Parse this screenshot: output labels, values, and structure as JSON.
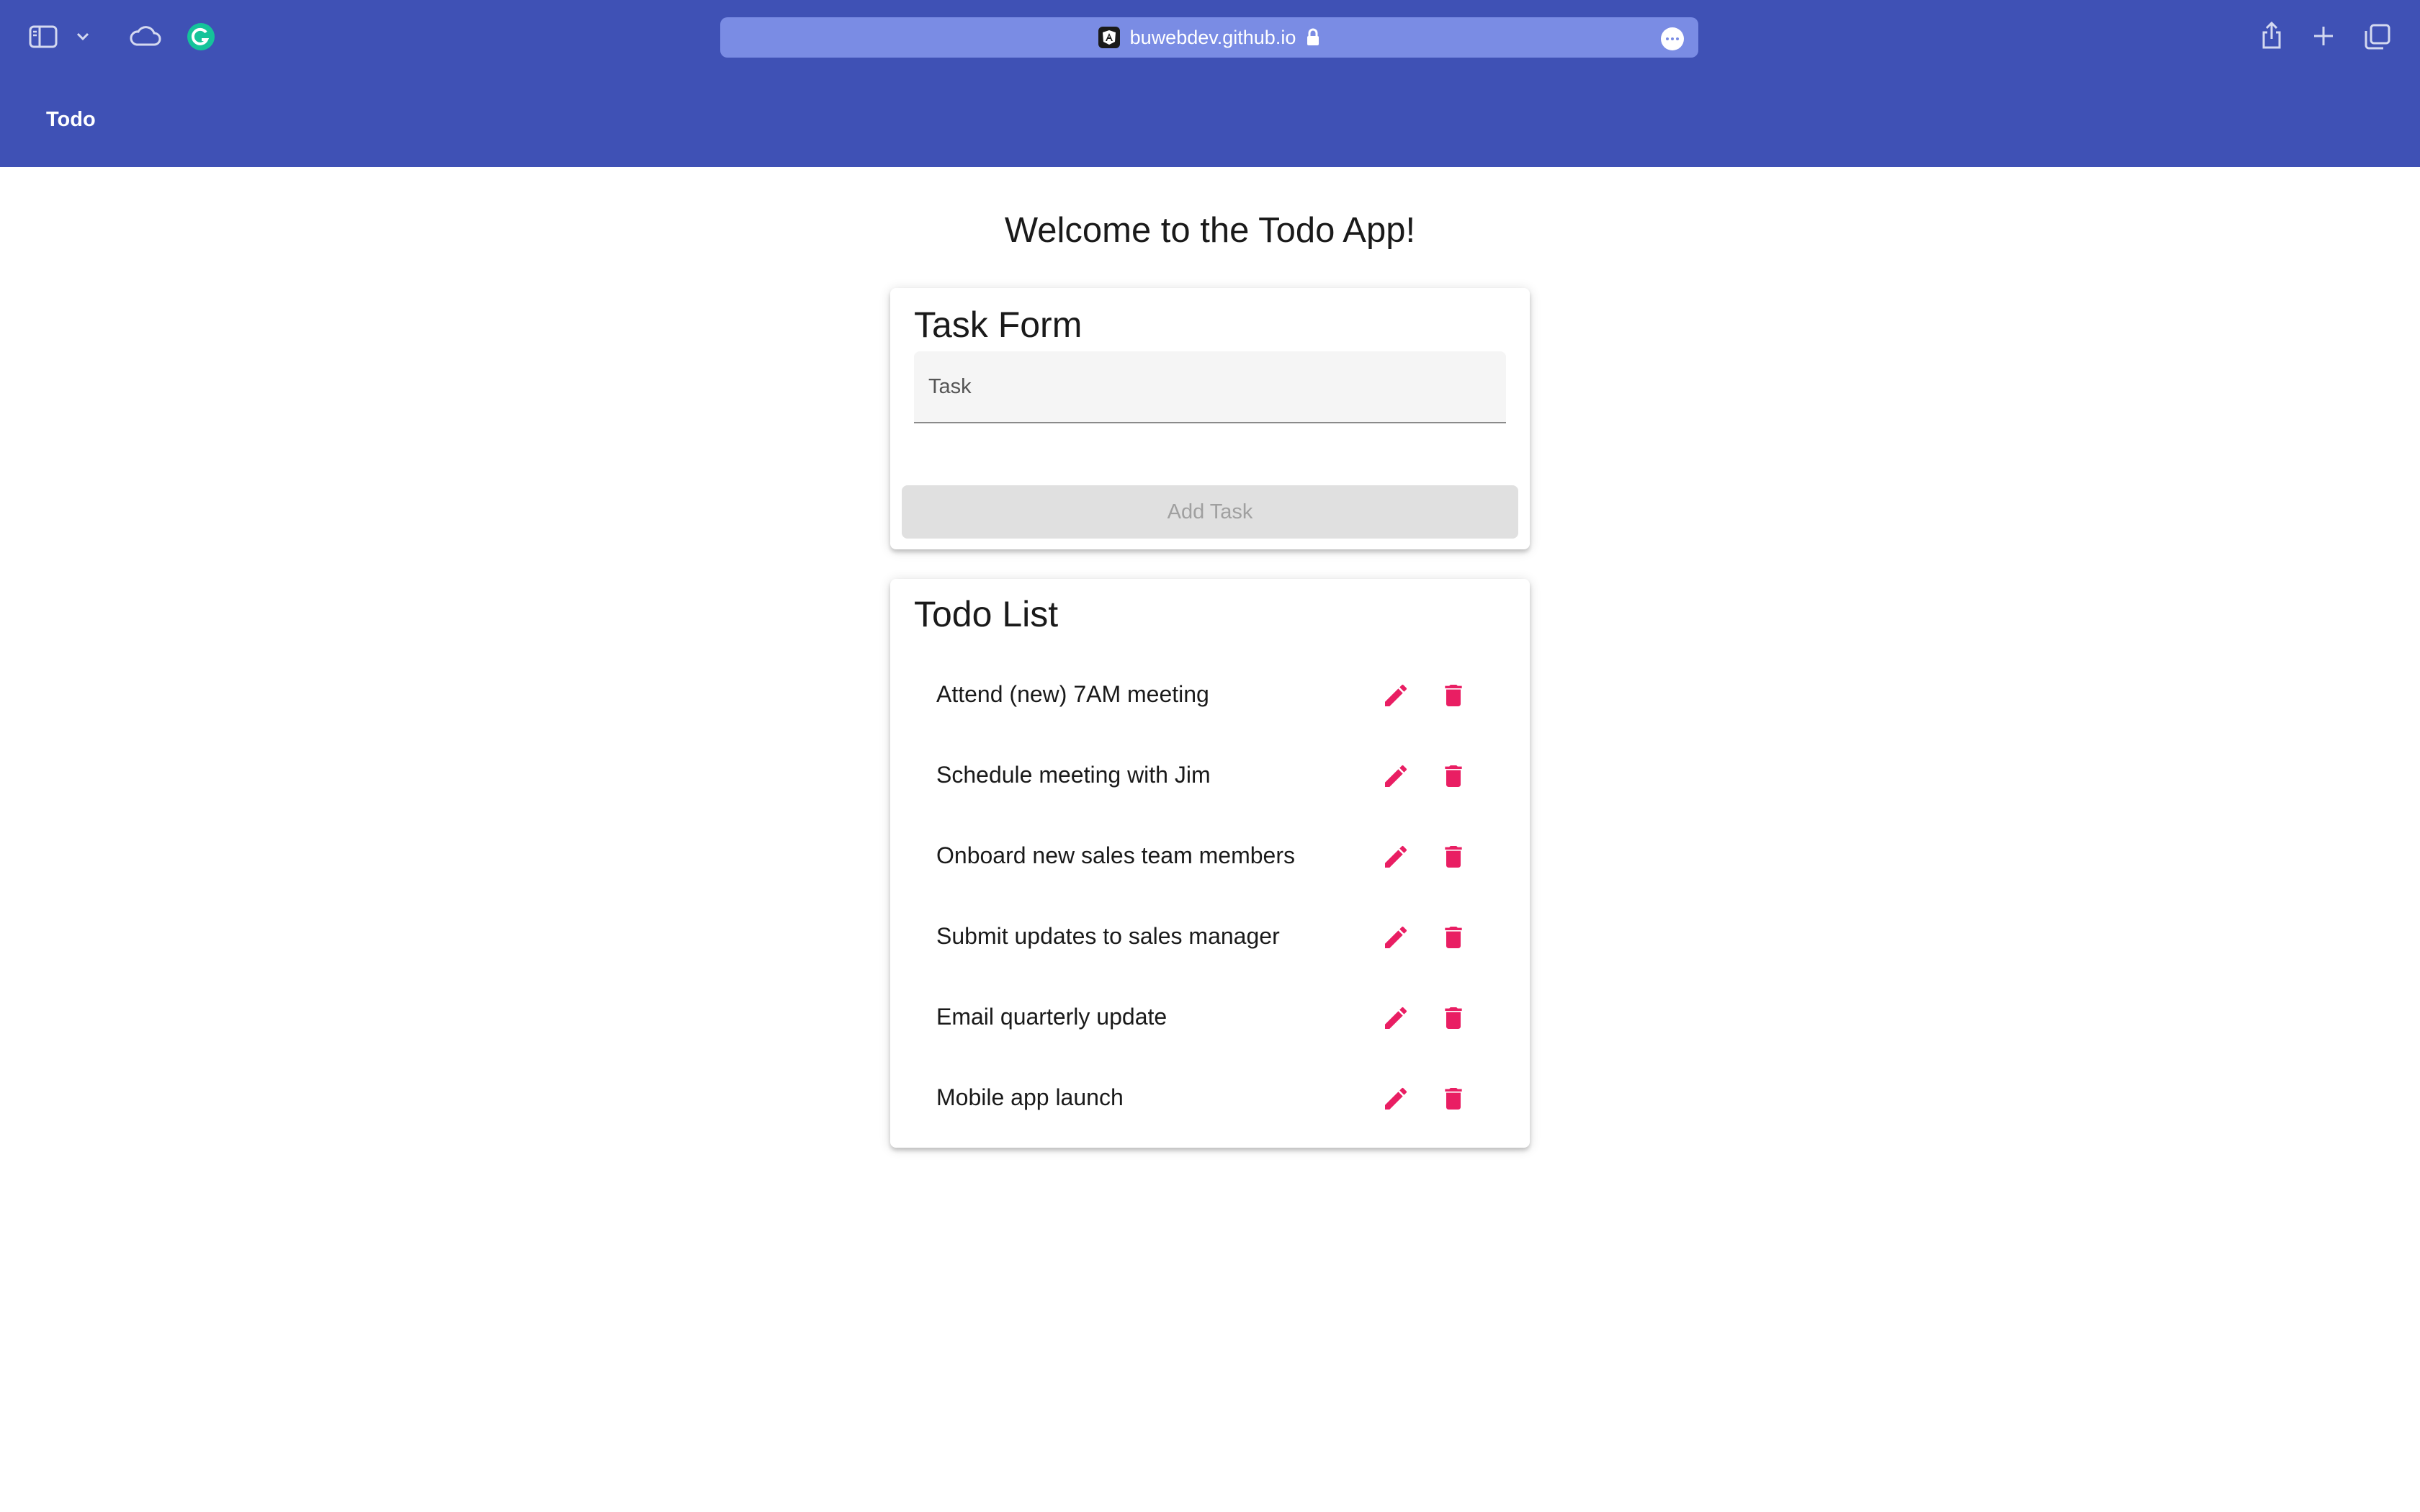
{
  "browser": {
    "url": "buwebdev.github.io",
    "icons": {
      "sidebar": "sidebar-icon",
      "chevron": "chevron-down-icon",
      "cloud": "cloud-icon",
      "grammarly": "grammarly-icon",
      "site": "angular-icon",
      "lock": "lock-icon",
      "more": "more-icon",
      "share": "share-icon",
      "new_tab": "plus-icon",
      "tabs": "tabs-overview-icon"
    }
  },
  "toolbar": {
    "title": "Todo"
  },
  "main": {
    "heading": "Welcome to the Todo App!"
  },
  "task_form": {
    "title": "Task Form",
    "task_placeholder": "Task",
    "task_value": "",
    "add_button_label": "Add Task"
  },
  "todo_list": {
    "title": "Todo List",
    "items": [
      {
        "text": "Attend (new) 7AM meeting"
      },
      {
        "text": "Schedule meeting with Jim"
      },
      {
        "text": "Onboard new sales team members"
      },
      {
        "text": "Submit updates to sales manager"
      },
      {
        "text": "Email quarterly update"
      },
      {
        "text": "Mobile app launch"
      }
    ],
    "action_icons": {
      "edit": "pencil-icon",
      "delete": "trash-icon"
    }
  },
  "colors": {
    "primary": "#3f51b5",
    "url_bar": "#7a8ce4",
    "accent": "#e91e63",
    "disabled_button": "#e0e0e0",
    "disabled_text": "#a0a0a0"
  }
}
